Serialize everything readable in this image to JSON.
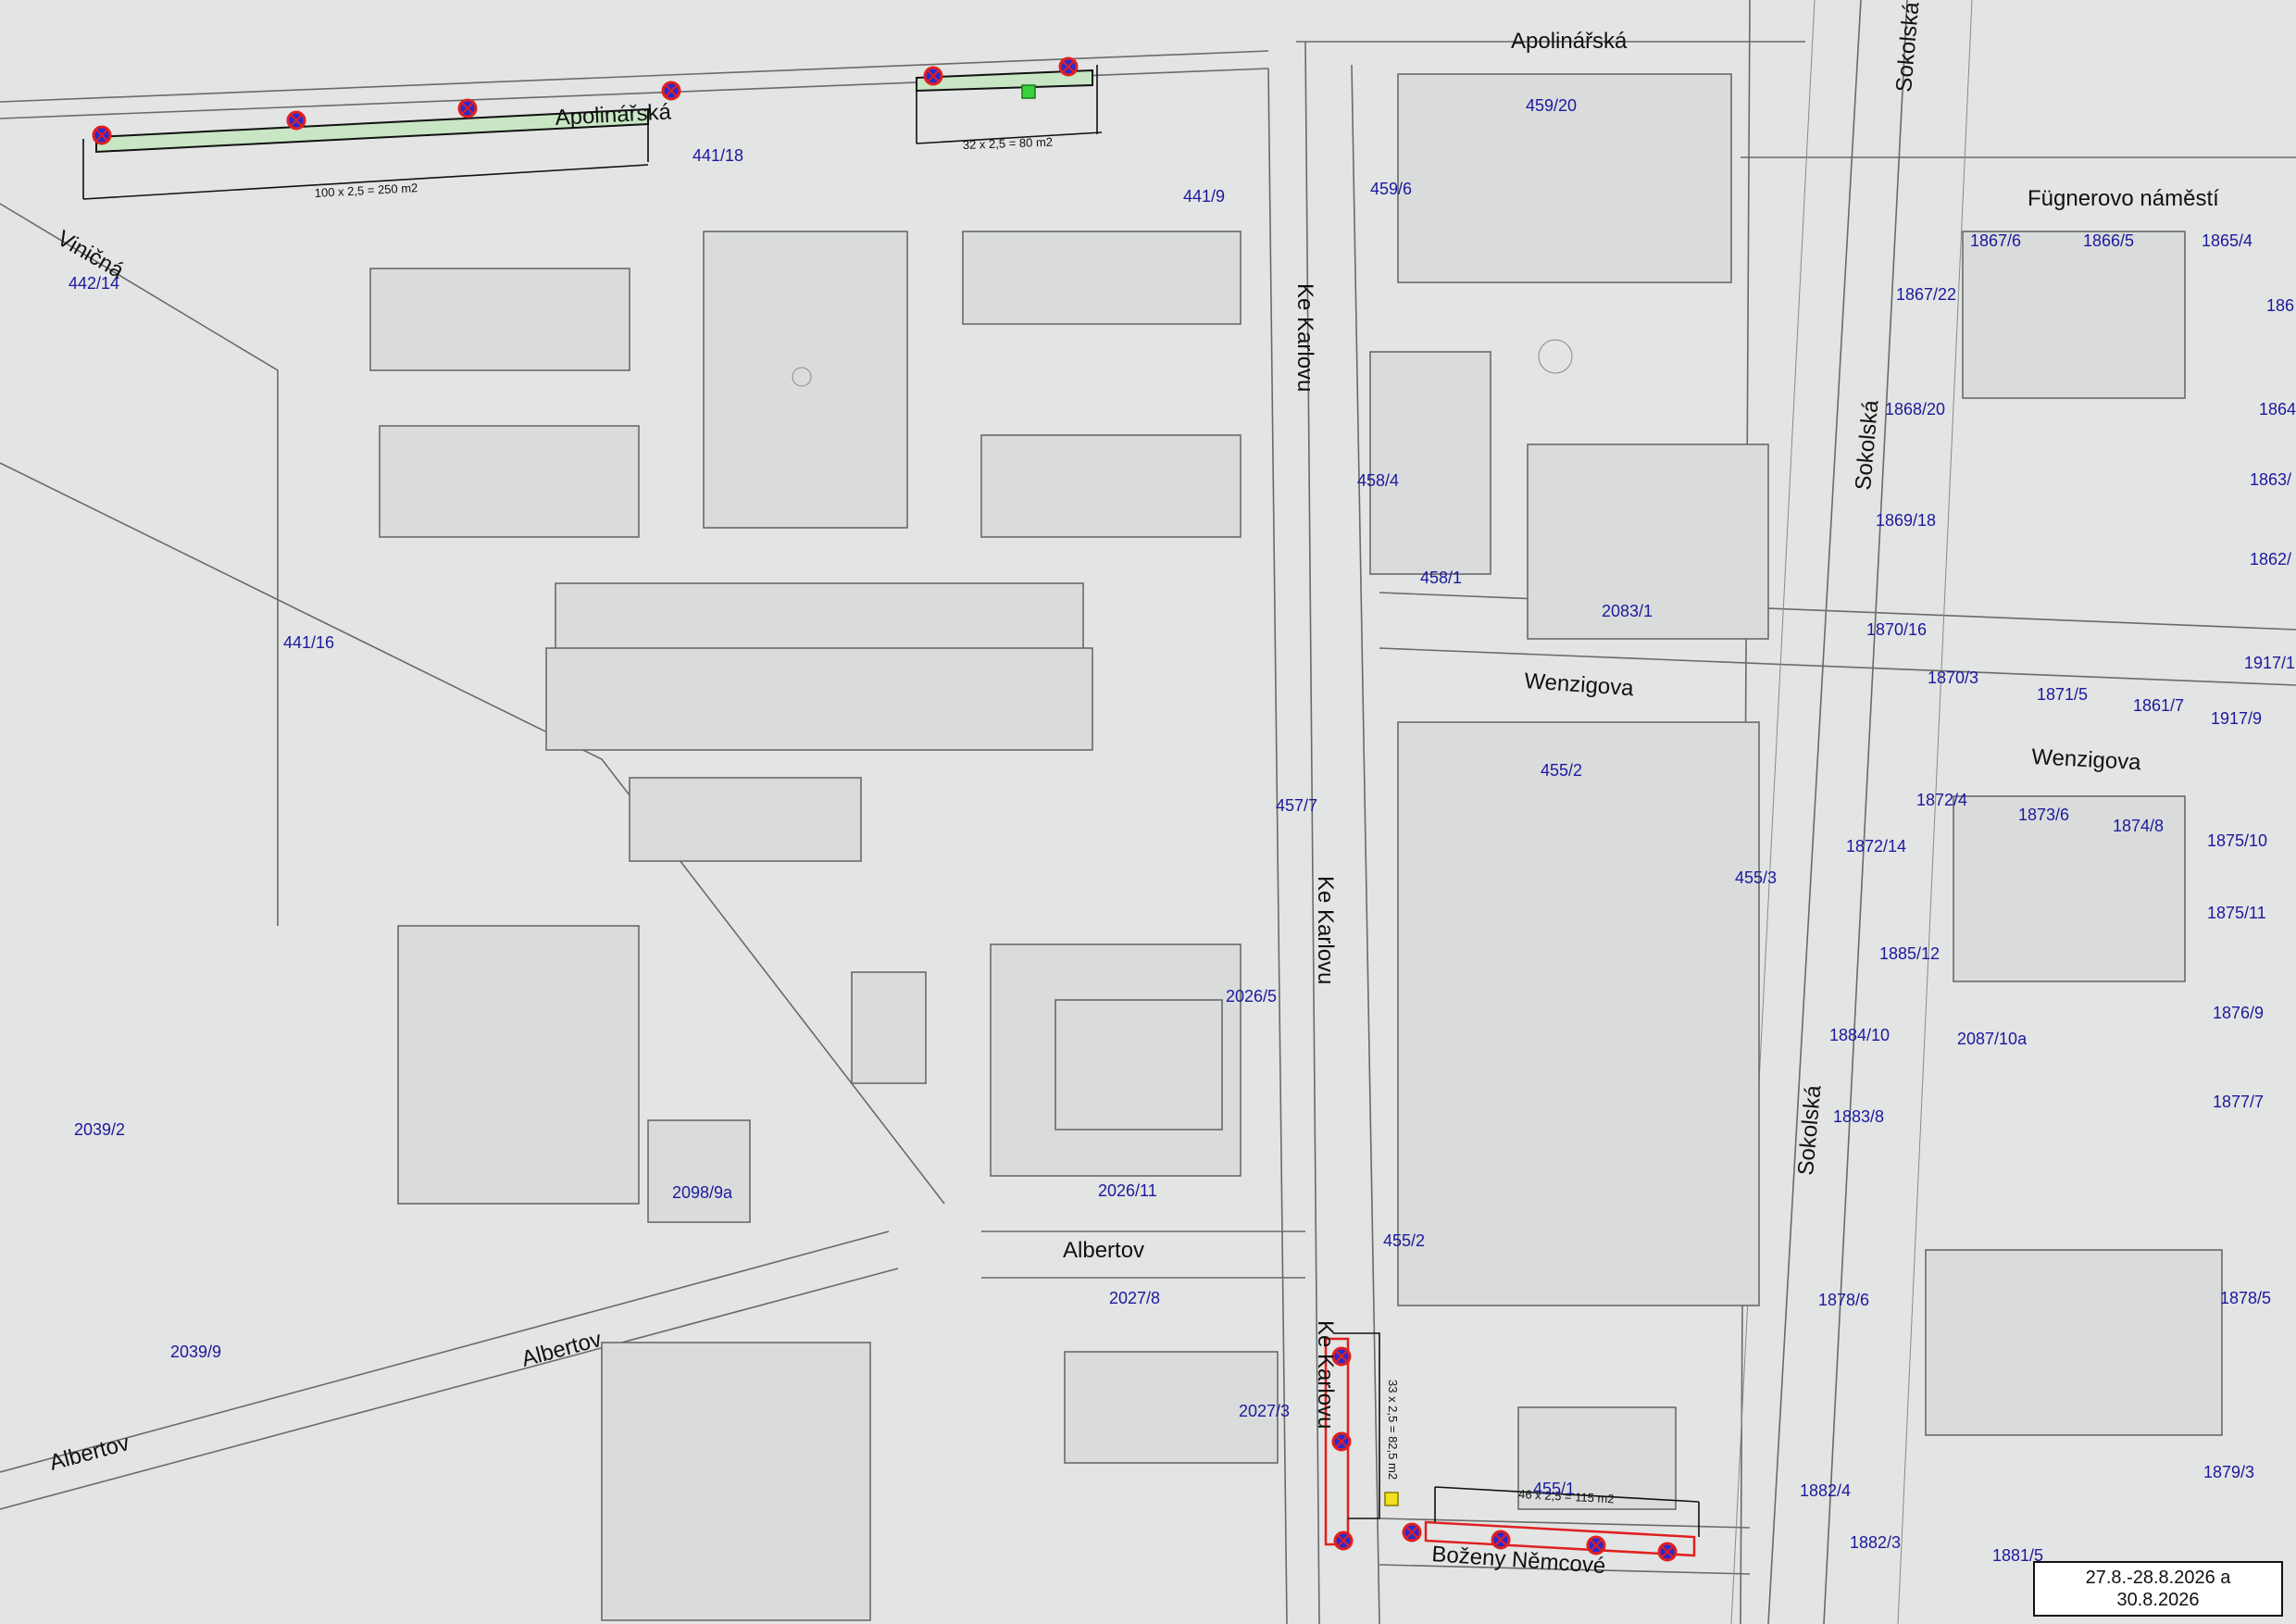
{
  "streets": {
    "apolinarska_top": "Apolinářská",
    "apolinarska_left": "Apolinářská",
    "vinicna": "Viničná",
    "fugnerovo": "Fügnerovo náměstí",
    "ke_karlovu_1": "Ke Karlovu",
    "ke_karlovu_2": "Ke Karlovu",
    "ke_karlovu_3": "Ke Karlovu",
    "sokolska_1": "Sokolská",
    "sokolska_2": "Sokolská",
    "sokolska_3": "Sokolská",
    "wenzigova_1": "Wenzigova",
    "wenzigova_2": "Wenzigova",
    "albertov_1": "Albertov",
    "albertov_2": "Albertov",
    "albertov_3": "Albertov",
    "bozeny_nemcove": "Boženy Němcové"
  },
  "parcels": {
    "p441_18": "441/18",
    "p442_14": "442/14",
    "p441_9": "441/9",
    "p441_16": "441/16",
    "p459_20": "459/20",
    "p459_6": "459/6",
    "p458_4": "458/4",
    "p458_1": "458/1",
    "p2083_1": "2083/1",
    "p455_2a": "455/2",
    "p455_2b": "455/2",
    "p455_3": "455/3",
    "p457_7": "457/7",
    "p2026_5": "2026/5",
    "p2026_11": "2026/11",
    "p2027_8": "2027/8",
    "p2027_3": "2027/3",
    "p2039_2": "2039/2",
    "p2039_9": "2039/9",
    "p2098_9a": "2098/9a",
    "p455_1": "455/1",
    "p1867_6": "1867/6",
    "p1866_5": "1866/5",
    "p1865_4": "1865/4",
    "p1867_22": "1867/22",
    "p1868_20": "1868/20",
    "p1869_18": "1869/18",
    "p1870_16": "1870/16",
    "p1870_3": "1870/3",
    "p1871_5": "1871/5",
    "p1861_7": "1861/7",
    "p1917_9": "1917/9",
    "p1917_1": "1917/1",
    "p1872_4": "1872/4",
    "p1873_6": "1873/6",
    "p1874_8": "1874/8",
    "p1875_10": "1875/10",
    "p1872_14": "1872/14",
    "p1875_11": "1875/11",
    "p1885_12": "1885/12",
    "p1876_9": "1876/9",
    "p1884_10": "1884/10",
    "p2087_10a": "2087/10a",
    "p1877_7": "1877/7",
    "p1883_8": "1883/8",
    "p1878_6": "1878/6",
    "p1878_5": "1878/5",
    "p1882_4": "1882/4",
    "p1882_3": "1882/3",
    "p1881_5": "1881/5",
    "p1879_3": "1879/3",
    "p1864": "1864",
    "p1863": "1863/",
    "p1862": "1862/",
    "p186_": "186"
  },
  "dimensions": {
    "zone_a": "100 x 2,5 = 250 m2",
    "zone_b": "32 x 2,5 = 80 m2",
    "zone_c": "33 x 2,5 = 82,5 m2",
    "zone_d": "46 x 2,5 = 115 m2"
  },
  "legend": {
    "line1": "27.8.-28.8.2026 a",
    "line2": "30.8.2026"
  },
  "colors": {
    "background": "#e3e4e4",
    "building_stroke": "#6a6a6a",
    "zone_green_fill": "#c8e6c4",
    "zone_red_stroke": "#e02020",
    "parcel_text": "#1a1a9c",
    "no_parking_sign": "#2a2ad0"
  },
  "icons": {
    "sign": "no-parking-sign-icon",
    "green_marker": "green-square-marker-icon",
    "yellow_marker": "yellow-square-marker-icon"
  }
}
